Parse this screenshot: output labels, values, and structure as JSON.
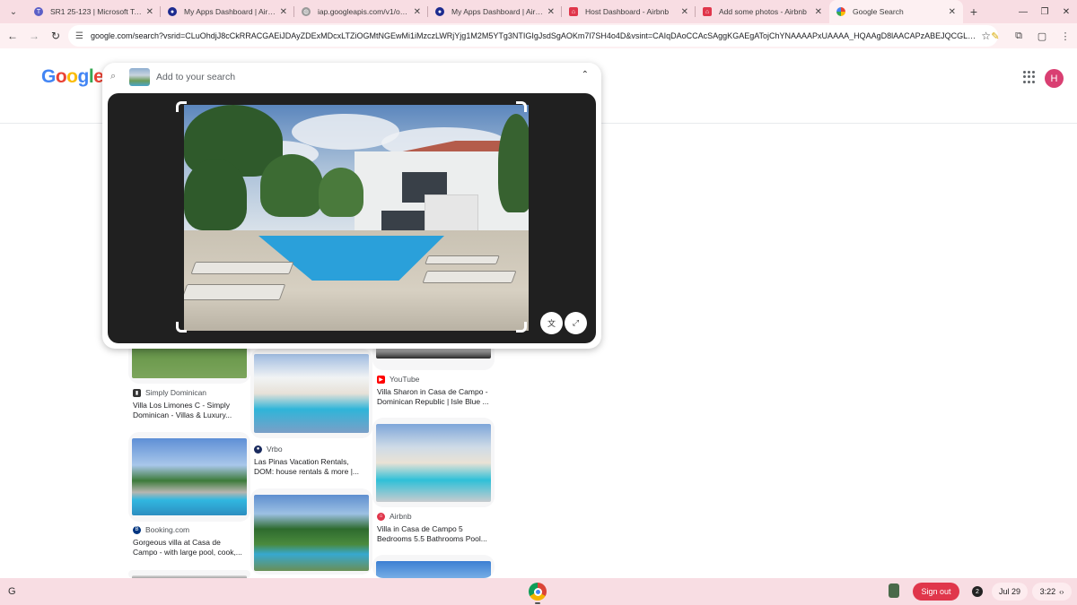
{
  "tabs": [
    {
      "title": "SR1 25-123 | Microsoft Teams",
      "icon": "teams-icon",
      "color": "#5b5fc7"
    },
    {
      "title": "My Apps Dashboard | Airbnb",
      "icon": "okta-icon",
      "color": "#1d2b8f"
    },
    {
      "title": "iap.googleapis.com/v1/oauth",
      "icon": "globe-icon",
      "color": "#7a7a7a"
    },
    {
      "title": "My Apps Dashboard | Airbnb",
      "icon": "okta-icon",
      "color": "#1d2b8f"
    },
    {
      "title": "Host Dashboard - Airbnb",
      "icon": "airbnb-icon",
      "color": "#e0364b"
    },
    {
      "title": "Add some photos - Airbnb",
      "icon": "airbnb-icon",
      "color": "#e0364b"
    },
    {
      "title": "Google Search",
      "icon": "google-icon",
      "color": "#4285f4",
      "active": true
    }
  ],
  "address": {
    "url": "google.com/search?vsrid=CLuOhdjJ8cCkRRACGAEiJDAyZDExMDcxLTZiOGMtNGEwMi1iMzczLWRjYjg1M2M5YTg3NTIGIgJsdSgAOKm7l7SH4o4D&vsint=CAIqDAoCCAcSAggKGAEgATojChYNAAAAPxUAAAA_HQAAgD8lAACAPzABEJQCGLcBJQAAgD8&u..."
  },
  "logo": {
    "letters": [
      {
        "ch": "G",
        "color": "#4285f4"
      },
      {
        "ch": "o",
        "color": "#ea4335"
      },
      {
        "ch": "o",
        "color": "#fbbc05"
      },
      {
        "ch": "g",
        "color": "#4285f4"
      },
      {
        "ch": "l",
        "color": "#34a853"
      },
      {
        "ch": "e",
        "color": "#ea4335"
      }
    ]
  },
  "avatar_initial": "H",
  "lens": {
    "placeholder": "Add to your search"
  },
  "results": {
    "col1": [
      {
        "source": "Simply Dominican",
        "title_l1": "Villa Los Limones C - Simply",
        "title_l2": "Dominican - Villas & Luxury..."
      },
      {
        "source": "Booking.com",
        "title_l1": "Gorgeous villa at Casa de",
        "title_l2": "Campo - with large pool, cook,..."
      }
    ],
    "col2": [
      {
        "source": "Vrbo",
        "title_l1": "Las Pinas Vacation Rentals,",
        "title_l2": "DOM: house rentals & more |..."
      }
    ],
    "col3": [
      {
        "source": "YouTube",
        "title_l1": "Villa Sharon in Casa de Campo -",
        "title_l2": "Dominican Republic | Isle Blue ..."
      },
      {
        "source": "Airbnb",
        "title_l1": "Villa in Casa de Campo 5",
        "title_l2": "Bedrooms 5.5 Bathrooms Pool..."
      }
    ]
  },
  "shelf": {
    "signout": "Sign out",
    "notifications": "2",
    "date": "Jul 29",
    "time": "3:22"
  },
  "colors": {
    "accent": "#e0364b",
    "tab_bg": "#f8dde3"
  }
}
